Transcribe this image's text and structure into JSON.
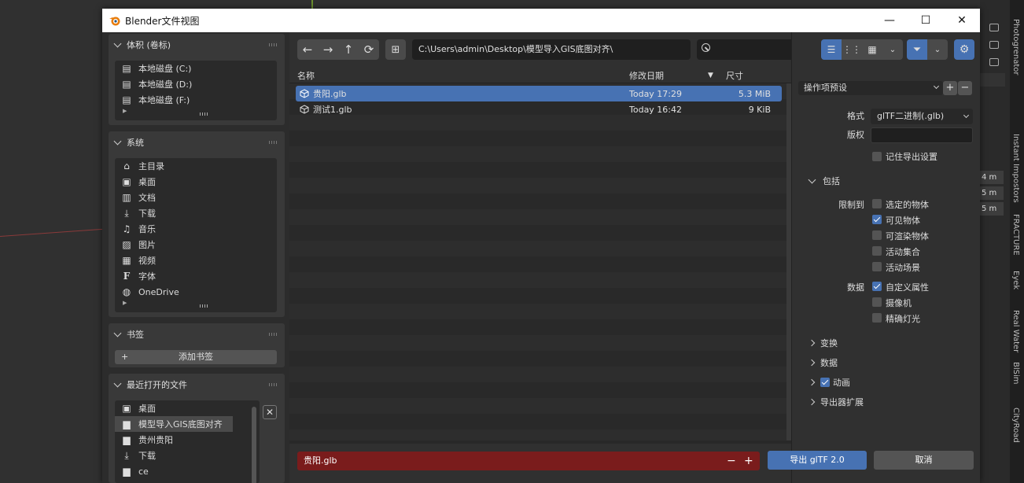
{
  "window": {
    "title": "Blender文件视图",
    "minimize": "—",
    "maximize": "☐",
    "close": "✕"
  },
  "sidebar": {
    "volumes": {
      "title": "体积 (卷标)",
      "items": [
        {
          "label": "本地磁盘 (C:)",
          "icon": "disk-icon"
        },
        {
          "label": "本地磁盘 (D:)",
          "icon": "disk-icon"
        },
        {
          "label": "本地磁盘 (F:)",
          "icon": "disk-icon"
        }
      ]
    },
    "system": {
      "title": "系统",
      "items": [
        {
          "label": "主目录",
          "icon": "home-icon"
        },
        {
          "label": "桌面",
          "icon": "desktop-icon"
        },
        {
          "label": "文档",
          "icon": "documents-icon"
        },
        {
          "label": "下载",
          "icon": "download-icon"
        },
        {
          "label": "音乐",
          "icon": "music-icon"
        },
        {
          "label": "图片",
          "icon": "pictures-icon"
        },
        {
          "label": "视频",
          "icon": "video-icon"
        },
        {
          "label": "字体",
          "icon": "font-icon"
        },
        {
          "label": "OneDrive",
          "icon": "globe-icon"
        }
      ]
    },
    "bookmarks": {
      "title": "书签",
      "add_label": "添加书签",
      "add_plus": "+"
    },
    "recent": {
      "title": "最近打开的文件",
      "clear": "✕",
      "items": [
        {
          "label": "桌面",
          "icon": "desktop-icon"
        },
        {
          "label": "模型导入GIS底图对齐",
          "icon": "folder-icon",
          "selected": true
        },
        {
          "label": "贵州贵阳",
          "icon": "folder-icon"
        },
        {
          "label": "下载",
          "icon": "download-icon"
        },
        {
          "label": "ce",
          "icon": "folder-icon"
        }
      ]
    }
  },
  "toolbar": {
    "path": "C:\\Users\\admin\\Desktop\\模型导入GIS底图对齐\\"
  },
  "filelist": {
    "columns": {
      "name": "名称",
      "date": "修改日期",
      "size": "尺寸"
    },
    "files": [
      {
        "name": "贵阳.glb",
        "date": "Today 17:29",
        "size": "5.3 MiB",
        "selected": true
      },
      {
        "name": "测试1.glb",
        "date": "Today 16:42",
        "size": "9 KiB",
        "selected": false
      }
    ]
  },
  "footer": {
    "filename": "贵阳.glb",
    "minus": "−",
    "plus": "+",
    "export_label": "导出 glTF 2.0",
    "cancel_label": "取消"
  },
  "settings": {
    "preset_label": "操作项预设",
    "preset_add": "+",
    "preset_remove": "−",
    "format_label": "格式",
    "format_value": "glTF二进制(.glb)",
    "copyright_label": "版权",
    "copyright_value": "",
    "remember_label": "记住导出设置",
    "include_title": "包括",
    "limit_label": "限制到",
    "limit_options": [
      {
        "label": "选定的物体",
        "checked": false
      },
      {
        "label": "可见物体",
        "checked": true
      },
      {
        "label": "可渲染物体",
        "checked": false
      },
      {
        "label": "活动集合",
        "checked": false
      },
      {
        "label": "活动场景",
        "checked": false
      }
    ],
    "data_label": "数据",
    "data_options": [
      {
        "label": "自定义属性",
        "checked": true
      },
      {
        "label": "摄像机",
        "checked": false
      },
      {
        "label": "精确灯光",
        "checked": false
      }
    ],
    "sections": [
      {
        "label": "变换",
        "checkbox": false,
        "checked": false
      },
      {
        "label": "数据",
        "checkbox": false,
        "checked": false
      },
      {
        "label": "动画",
        "checkbox": true,
        "checked": true
      },
      {
        "label": "导出器扩展",
        "checkbox": false,
        "checked": false
      }
    ]
  },
  "background": {
    "fields": [
      "4 m",
      "5 m",
      "5 m"
    ],
    "tabs": [
      "Photogrenator",
      "Instant Impostors",
      "FRACTURE",
      "Eyek",
      "Real Water",
      "BlSim",
      "CityRoad"
    ]
  },
  "colors": {
    "accent": "#4772b3",
    "filename_bg": "#7a1c1c",
    "title_bg": "#ffffff"
  }
}
